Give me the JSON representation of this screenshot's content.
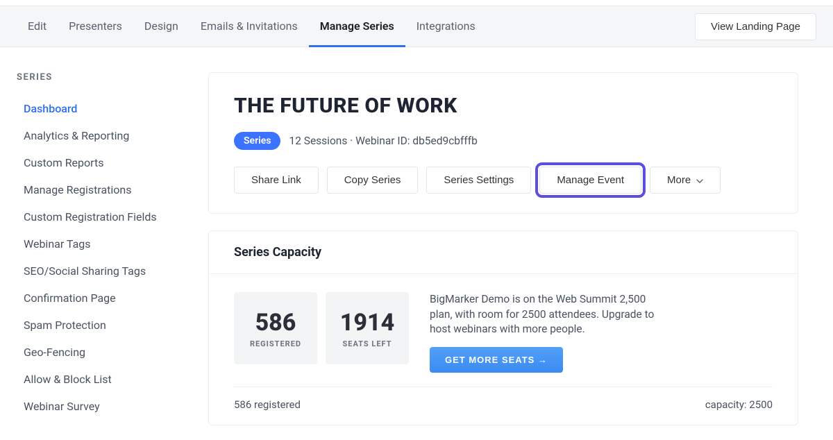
{
  "topnav": {
    "items": [
      {
        "label": "Edit"
      },
      {
        "label": "Presenters"
      },
      {
        "label": "Design"
      },
      {
        "label": "Emails & Invitations"
      },
      {
        "label": "Manage Series"
      },
      {
        "label": "Integrations"
      }
    ],
    "view_landing": "View Landing Page"
  },
  "sidebar": {
    "heading": "SERIES",
    "items": [
      {
        "label": "Dashboard"
      },
      {
        "label": "Analytics & Reporting"
      },
      {
        "label": "Custom Reports"
      },
      {
        "label": "Manage Registrations"
      },
      {
        "label": "Custom Registration Fields"
      },
      {
        "label": "Webinar Tags"
      },
      {
        "label": "SEO/Social Sharing Tags"
      },
      {
        "label": "Confirmation Page"
      },
      {
        "label": "Spam Protection"
      },
      {
        "label": "Geo-Fencing"
      },
      {
        "label": "Allow & Block List"
      },
      {
        "label": "Webinar Survey"
      }
    ]
  },
  "header": {
    "title": "THE FUTURE OF WORK",
    "badge": "Series",
    "meta": "12 Sessions · Webinar ID: db5ed9cbfffb"
  },
  "actions": {
    "share": "Share Link",
    "copy": "Copy Series",
    "settings": "Series Settings",
    "manage_event": "Manage Event",
    "more": "More"
  },
  "capacity": {
    "title": "Series Capacity",
    "registered_num": "586",
    "registered_label": "REGISTERED",
    "seats_left_num": "1914",
    "seats_left_label": "SEATS LEFT",
    "desc": "BigMarker Demo is on the Web Summit 2,500 plan, with room for 2500 attendees. Upgrade to host webinars with more people.",
    "get_more": "GET MORE SEATS →",
    "footer_left": "586 registered",
    "footer_right": "capacity: 2500"
  }
}
